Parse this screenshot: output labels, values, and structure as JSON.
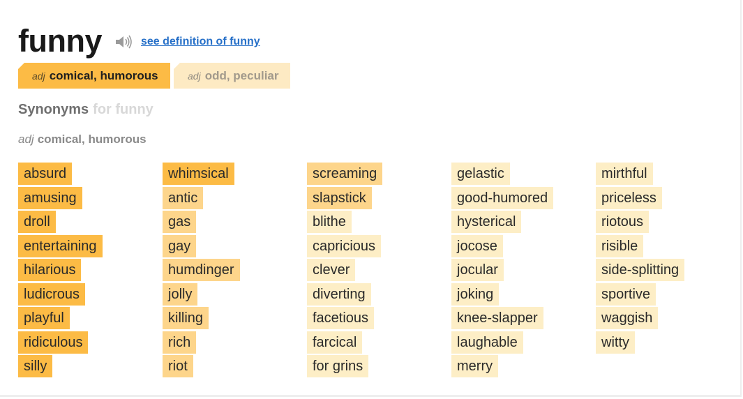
{
  "entry": {
    "headword": "funny",
    "definition_link": "see definition of funny"
  },
  "tabs": [
    {
      "pos": "adj",
      "label": "comical, humorous",
      "active": true
    },
    {
      "pos": "adj",
      "label": "odd, peculiar",
      "active": false
    }
  ],
  "synonyms_heading": {
    "label": "Synonyms",
    "for_text": "for funny"
  },
  "sense": {
    "pos": "adj",
    "label": "comical, humorous"
  },
  "colors": {
    "strongest": "#fcbb45",
    "strong": "#fdd58b",
    "related": "#fdeec6",
    "link": "#2770c8"
  },
  "columns": [
    [
      {
        "word": "absurd",
        "strength": "strongest"
      },
      {
        "word": "amusing",
        "strength": "strongest"
      },
      {
        "word": "droll",
        "strength": "strongest"
      },
      {
        "word": "entertaining",
        "strength": "strongest"
      },
      {
        "word": "hilarious",
        "strength": "strongest"
      },
      {
        "word": "ludicrous",
        "strength": "strongest"
      },
      {
        "word": "playful",
        "strength": "strongest"
      },
      {
        "word": "ridiculous",
        "strength": "strongest"
      },
      {
        "word": "silly",
        "strength": "strongest"
      }
    ],
    [
      {
        "word": "whimsical",
        "strength": "strongest"
      },
      {
        "word": "antic",
        "strength": "strong"
      },
      {
        "word": "gas",
        "strength": "strong"
      },
      {
        "word": "gay",
        "strength": "strong"
      },
      {
        "word": "humdinger",
        "strength": "strong"
      },
      {
        "word": "jolly",
        "strength": "strong"
      },
      {
        "word": "killing",
        "strength": "strong"
      },
      {
        "word": "rich",
        "strength": "strong"
      },
      {
        "word": "riot",
        "strength": "strong"
      }
    ],
    [
      {
        "word": "screaming",
        "strength": "strong"
      },
      {
        "word": "slapstick",
        "strength": "strong"
      },
      {
        "word": "blithe",
        "strength": "related"
      },
      {
        "word": "capricious",
        "strength": "related"
      },
      {
        "word": "clever",
        "strength": "related"
      },
      {
        "word": "diverting",
        "strength": "related"
      },
      {
        "word": "facetious",
        "strength": "related"
      },
      {
        "word": "farcical",
        "strength": "related"
      },
      {
        "word": "for grins",
        "strength": "related"
      }
    ],
    [
      {
        "word": "gelastic",
        "strength": "related"
      },
      {
        "word": "good-humored",
        "strength": "related"
      },
      {
        "word": "hysterical",
        "strength": "related"
      },
      {
        "word": "jocose",
        "strength": "related"
      },
      {
        "word": "jocular",
        "strength": "related"
      },
      {
        "word": "joking",
        "strength": "related"
      },
      {
        "word": "knee-slapper",
        "strength": "related"
      },
      {
        "word": "laughable",
        "strength": "related"
      },
      {
        "word": "merry",
        "strength": "related"
      }
    ],
    [
      {
        "word": "mirthful",
        "strength": "related"
      },
      {
        "word": "priceless",
        "strength": "related"
      },
      {
        "word": "riotous",
        "strength": "related"
      },
      {
        "word": "risible",
        "strength": "related"
      },
      {
        "word": "side-splitting",
        "strength": "related"
      },
      {
        "word": "sportive",
        "strength": "related"
      },
      {
        "word": "waggish",
        "strength": "related"
      },
      {
        "word": "witty",
        "strength": "related"
      }
    ]
  ]
}
